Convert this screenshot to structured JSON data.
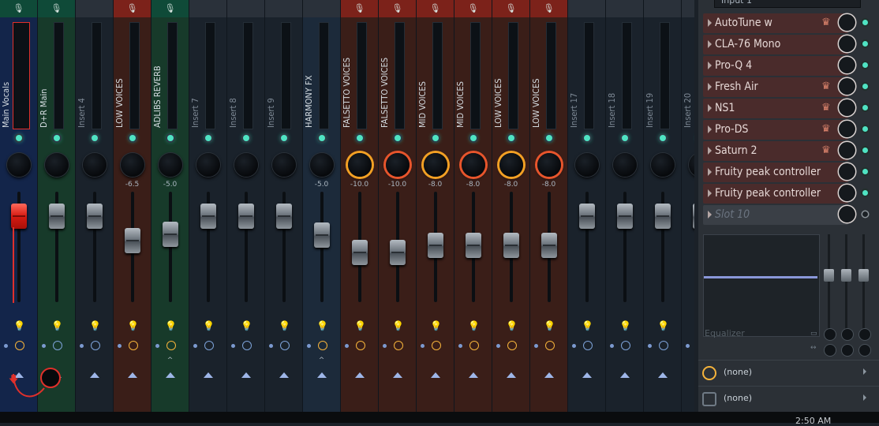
{
  "mixer": {
    "strips": [
      {
        "name": "Main Vocals",
        "hdr": "#0f4a38",
        "body": "#13254a",
        "mic": true,
        "selected": true,
        "knob": "",
        "kval": "",
        "fader": "red",
        "faderTop": 258,
        "bulb": true,
        "clock": true,
        "caret": "",
        "arrow": true,
        "dim": false
      },
      {
        "name": "D+R Main",
        "hdr": "#0f4a38",
        "body": "#173a2a",
        "mic": true,
        "selected": false,
        "knob": "",
        "kval": "",
        "fader": "",
        "faderTop": 258,
        "bulb": true,
        "clock": false,
        "caret": "",
        "arrow": false,
        "dim": false
      },
      {
        "name": "Insert 4",
        "hdr": "#2a313a",
        "body": "#1a222b",
        "mic": false,
        "selected": false,
        "knob": "",
        "kval": "",
        "fader": "",
        "faderTop": 258,
        "bulb": false,
        "clock": false,
        "caret": "",
        "arrow": true,
        "dim": true
      },
      {
        "name": "LOW VOICES",
        "hdr": "#7c221a",
        "body": "#3a1e18",
        "mic": true,
        "selected": false,
        "knob": "",
        "kval": "-6.5",
        "fader": "",
        "faderTop": 289,
        "bulb": true,
        "clock": true,
        "caret": "",
        "arrow": true,
        "dim": false
      },
      {
        "name": "ADLIBS REVERB",
        "hdr": "#0f4a38",
        "body": "#173a2a",
        "mic": true,
        "selected": false,
        "knob": "",
        "kval": "-5.0",
        "fader": "",
        "faderTop": 281,
        "bulb": true,
        "clock": true,
        "caret": "^",
        "arrow": true,
        "dim": false
      },
      {
        "name": "Insert 7",
        "hdr": "#2a313a",
        "body": "#1a222b",
        "mic": false,
        "selected": false,
        "knob": "",
        "kval": "",
        "fader": "",
        "faderTop": 258,
        "bulb": false,
        "clock": false,
        "caret": "",
        "arrow": true,
        "dim": true
      },
      {
        "name": "Insert 8",
        "hdr": "#2a313a",
        "body": "#1a222b",
        "mic": false,
        "selected": false,
        "knob": "",
        "kval": "",
        "fader": "",
        "faderTop": 258,
        "bulb": false,
        "clock": false,
        "caret": "",
        "arrow": true,
        "dim": true
      },
      {
        "name": "Insert 9",
        "hdr": "#2a313a",
        "body": "#1a222b",
        "mic": false,
        "selected": false,
        "knob": "",
        "kval": "",
        "fader": "",
        "faderTop": 258,
        "bulb": false,
        "clock": false,
        "caret": "",
        "arrow": true,
        "dim": true
      },
      {
        "name": "HARMONY FX",
        "hdr": "#2a313a",
        "body": "#1c2a3a",
        "mic": false,
        "selected": false,
        "knob": "",
        "kval": "-5.0",
        "fader": "",
        "faderTop": 282,
        "bulb": true,
        "clock": true,
        "caret": "^",
        "arrow": true,
        "dim": false
      },
      {
        "name": "FALSETTO VOICES",
        "hdr": "#7c221a",
        "body": "#3a1e18",
        "mic": true,
        "selected": false,
        "knob": "o",
        "kval": "-10.0",
        "fader": "",
        "faderTop": 304,
        "bulb": true,
        "clock": true,
        "caret": "",
        "arrow": true,
        "dim": false
      },
      {
        "name": "FALSETTO VOICES",
        "hdr": "#7c221a",
        "body": "#3a1e18",
        "mic": true,
        "selected": false,
        "knob": "r",
        "kval": "-10.0",
        "fader": "",
        "faderTop": 304,
        "bulb": true,
        "clock": true,
        "caret": "",
        "arrow": true,
        "dim": false
      },
      {
        "name": "MID VOICES",
        "hdr": "#7c221a",
        "body": "#3a1e18",
        "mic": true,
        "selected": false,
        "knob": "o",
        "kval": "-8.0",
        "fader": "",
        "faderTop": 295,
        "bulb": true,
        "clock": true,
        "caret": "",
        "arrow": true,
        "dim": false
      },
      {
        "name": "MID VOICES",
        "hdr": "#7c221a",
        "body": "#3a1e18",
        "mic": true,
        "selected": false,
        "knob": "r",
        "kval": "-8.0",
        "fader": "",
        "faderTop": 295,
        "bulb": true,
        "clock": true,
        "caret": "",
        "arrow": true,
        "dim": false
      },
      {
        "name": "LOW VOICES",
        "hdr": "#7c221a",
        "body": "#3a1e18",
        "mic": true,
        "selected": false,
        "knob": "o",
        "kval": "-8.0",
        "fader": "",
        "faderTop": 295,
        "bulb": true,
        "clock": true,
        "caret": "",
        "arrow": true,
        "dim": false
      },
      {
        "name": "LOW VOICES",
        "hdr": "#7c221a",
        "body": "#3a1e18",
        "mic": true,
        "selected": false,
        "knob": "r",
        "kval": "-8.0",
        "fader": "",
        "faderTop": 295,
        "bulb": true,
        "clock": true,
        "caret": "",
        "arrow": true,
        "dim": false
      },
      {
        "name": "Insert 17",
        "hdr": "#2a313a",
        "body": "#1a222b",
        "mic": false,
        "selected": false,
        "knob": "",
        "kval": "",
        "fader": "",
        "faderTop": 258,
        "bulb": false,
        "clock": false,
        "caret": "",
        "arrow": true,
        "dim": true
      },
      {
        "name": "Insert 18",
        "hdr": "#2a313a",
        "body": "#1a222b",
        "mic": false,
        "selected": false,
        "knob": "",
        "kval": "",
        "fader": "",
        "faderTop": 258,
        "bulb": false,
        "clock": false,
        "caret": "",
        "arrow": true,
        "dim": true
      },
      {
        "name": "Insert 19",
        "hdr": "#2a313a",
        "body": "#1a222b",
        "mic": false,
        "selected": false,
        "knob": "",
        "kval": "",
        "fader": "",
        "faderTop": 258,
        "bulb": false,
        "clock": false,
        "caret": "",
        "arrow": true,
        "dim": true
      },
      {
        "name": "Insert 20",
        "hdr": "#2a313a",
        "body": "#1a222b",
        "mic": false,
        "selected": false,
        "knob": "",
        "kval": "",
        "fader": "",
        "faderTop": 258,
        "bulb": false,
        "clock": false,
        "caret": "",
        "arrow": true,
        "dim": true
      }
    ]
  },
  "panel": {
    "input_label": "Input 1",
    "slots": [
      {
        "label": "AutoTune w",
        "crown": true,
        "active": true
      },
      {
        "label": "CLA-76 Mono",
        "crown": false,
        "active": true
      },
      {
        "label": "Pro-Q 4",
        "crown": false,
        "active": true
      },
      {
        "label": "Fresh Air",
        "crown": true,
        "active": true
      },
      {
        "label": "NS1",
        "crown": true,
        "active": true
      },
      {
        "label": "Pro-DS",
        "crown": true,
        "active": true
      },
      {
        "label": "Saturn 2",
        "crown": true,
        "active": true
      },
      {
        "label": "Fruity peak controller",
        "crown": false,
        "active": true
      },
      {
        "label": "Fruity peak controller",
        "crown": false,
        "active": true
      },
      {
        "label": "Slot 10",
        "crown": false,
        "active": false
      }
    ],
    "eq_label": "Equalizer",
    "route_in": "(none)",
    "route_out": "(none)"
  },
  "clock": "2:50 AM",
  "colors": {
    "accent": "#f5b33b",
    "led": "#4fe3c3",
    "select": "#e0302b",
    "plugin_bg": "#4a2b2b",
    "plugin_bg_empty": "#3a3f46"
  }
}
